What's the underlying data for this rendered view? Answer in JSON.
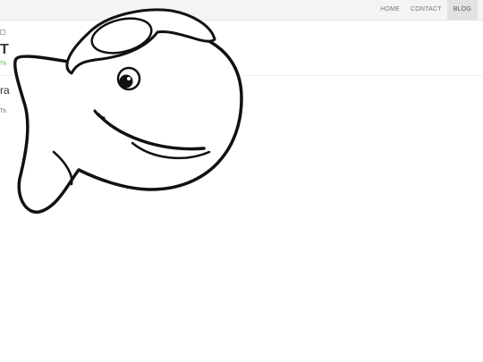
{
  "nav": {
    "items": [
      {
        "label": "HOME"
      },
      {
        "label": "CONTACT"
      },
      {
        "label": "BLOG",
        "active": true
      }
    ]
  },
  "post": {
    "title": "T",
    "meta": "Th",
    "subheading": "ra",
    "snippet": "Th"
  },
  "overlay_image": {
    "icon": "fish-with-sunglasses-illustration"
  }
}
